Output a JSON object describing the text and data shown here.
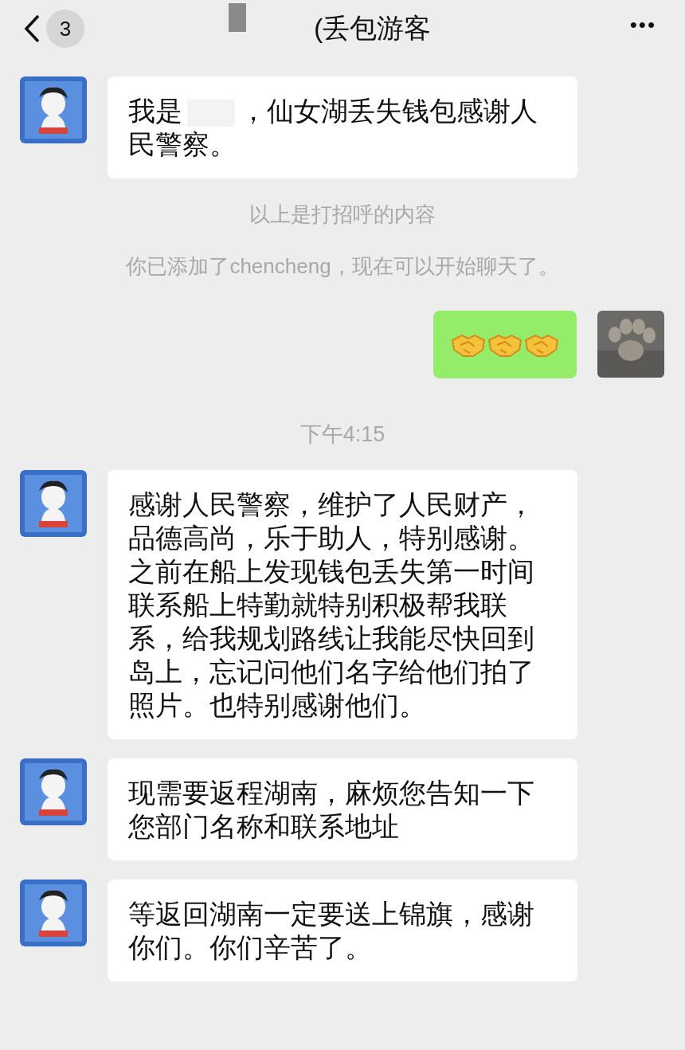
{
  "header": {
    "back_badge": "3",
    "title": "(丢包游客",
    "more": "•••"
  },
  "messages": [
    {
      "kind": "incoming",
      "parts": [
        {
          "kind": "text",
          "text": "我是"
        },
        {
          "kind": "redacted"
        },
        {
          "kind": "text",
          "text": "，仙女湖丢失钱包感谢人民警察。"
        }
      ]
    },
    {
      "kind": "system",
      "text": "以上是打招呼的内容"
    },
    {
      "kind": "system",
      "text": "你已添加了chencheng，现在可以开始聊天了。"
    },
    {
      "kind": "outgoing_emoji",
      "icons": [
        {
          "kind": "handshake"
        },
        {
          "kind": "handshake"
        },
        {
          "kind": "handshake"
        }
      ]
    },
    {
      "kind": "time",
      "text": "下午4:15"
    },
    {
      "kind": "incoming",
      "parts": [
        {
          "kind": "text",
          "text": "感谢人民警察，维护了人民财产，品德高尚，乐于助人，特别感谢。之前在船上发现钱包丢失第一时间联系船上特勤就特别积极帮我联系，给我规划路线让我能尽快回到岛上，忘记问他们名字给他们拍了照片。也特别感谢他们。"
        }
      ]
    },
    {
      "kind": "incoming",
      "parts": [
        {
          "kind": "text",
          "text": "现需要返程湖南，麻烦您告知一下您部门名称和联系地址"
        }
      ]
    },
    {
      "kind": "incoming",
      "parts": [
        {
          "kind": "text",
          "text": "等返回湖南一定要送上锦旗，感谢你们。你们辛苦了。"
        }
      ]
    }
  ]
}
